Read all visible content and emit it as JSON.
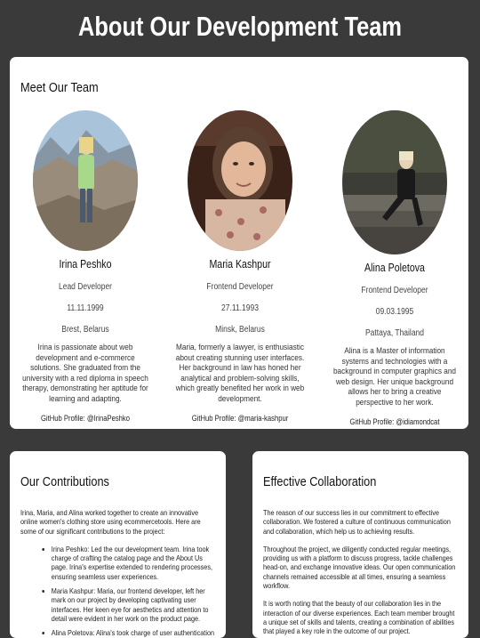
{
  "page": {
    "title": "About Our Development Team"
  },
  "team_section": {
    "heading": "Meet Our Team",
    "members": [
      {
        "name": "Irina Peshko",
        "role": "Lead Developer",
        "birthdate": "11.11.1999",
        "location": "Brest, Belarus",
        "bio": "Irina is passionate about web development and e-commerce solutions. She graduated from the university with a red diploma in speech therapy, demonstrating her aptitude for learning and adapting.",
        "github": "GitHub Profile: @IrinaPeshko"
      },
      {
        "name": "Maria Kashpur",
        "role": "Frontend Developer",
        "birthdate": "27.11.1993",
        "location": "Minsk, Belarus",
        "bio": "Maria, formerly a lawyer, is enthusiastic about creating stunning user interfaces. Her background in law has honed her analytical and problem-solving skills, which greatly benefited her work in web development.",
        "github": "GitHub Profile: @maria-kashpur"
      },
      {
        "name": "Alina Poletova",
        "role": "Frontend Developer",
        "birthdate": "09.03.1995",
        "location": "Pattaya, Thailand",
        "bio": "Alina is a Master of information systems and technologies with a background in computer graphics and web design. Her unique background allows her to bring a creative perspective to her work.",
        "github": "GitHub Profile: @idiamondcat"
      }
    ]
  },
  "contributions": {
    "heading": "Our Contributions",
    "intro": "Irina, Maria, and Alina worked together to create an innovative online women's clothing store using ecommercetools. Here are some of our significant contributions to the project:",
    "items": [
      "Irina Peshko: Led the our development team. Irina took charge of crafting the catalog page and the About Us page. Irina's expertise extended to rendering processes, ensuring seamless user experiences.",
      "Maria Kashpur: Maria, our frontend developer, left her mark on our project by developing captivating user interfaces. Her keen eye for aesthetics and attention to detail were evident in her work on the product page.",
      "Alina Poletova: Alina's took charge of user authentication"
    ]
  },
  "collaboration": {
    "heading": "Effective Collaboration",
    "paragraphs": [
      "The reason of our success lies in our commitment to effective collaboration. We fostered a culture of continuous communication and collaboration, which help us to achieving results.",
      "Throughout the project, we diligently conducted regular meetings, providing us with a platform to discuss progress, tackle challenges head-on, and exchange innovative ideas. Our open communication channels remained accessible at all times, ensuring a seamless workflow.",
      "It is worth noting that the beauty of our collaboration lies in the interaction of our diverse experiences. Each team member brought a unique set of skills and talents, creating a combination of abilities that played a key role in the outcome of our project."
    ]
  }
}
